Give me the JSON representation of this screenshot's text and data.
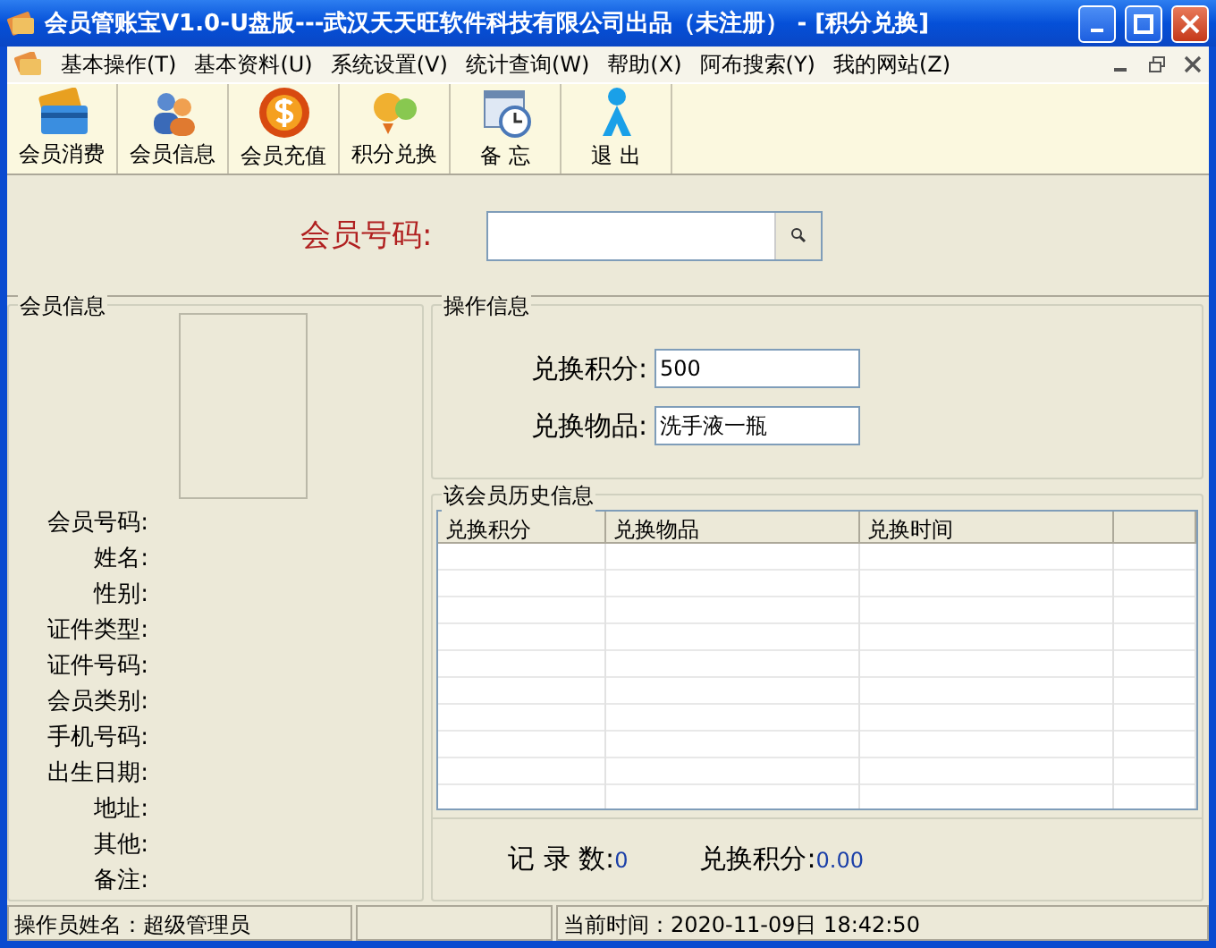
{
  "window": {
    "title": "会员管账宝V1.0-U盘版---武汉天天旺软件科技有限公司出品（未注册） - [积分兑换]"
  },
  "menu": [
    "基本操作(T)",
    "基本资料(U)",
    "系统设置(V)",
    "统计查询(W)",
    "帮助(X)",
    "阿布搜索(Y)",
    "我的网站(Z)"
  ],
  "toolbar": [
    {
      "kind": "card",
      "label": "会员消费"
    },
    {
      "kind": "people",
      "label": "会员信息"
    },
    {
      "kind": "coin",
      "label": "会员充值"
    },
    {
      "kind": "exchange",
      "label": "积分兑换"
    },
    {
      "kind": "memo",
      "label": "备 忘"
    },
    {
      "kind": "exit",
      "label": "退 出"
    }
  ],
  "search": {
    "label": "会员号码:"
  },
  "member_info": {
    "title": "会员信息",
    "fields": [
      "会员号码:",
      "姓名:",
      "性别:",
      "证件类型:",
      "证件号码:",
      "会员类别:",
      "手机号码:",
      "出生日期:",
      "地址:",
      "其他:",
      "备注:"
    ]
  },
  "operation": {
    "title": "操作信息",
    "fields": [
      {
        "label": "兑换积分:",
        "value": "500"
      },
      {
        "label": "兑换物品:",
        "value": "洗手液一瓶"
      }
    ]
  },
  "history": {
    "title": "该会员历史信息",
    "columns": [
      "兑换积分",
      "兑换物品",
      "兑换时间"
    ]
  },
  "summary": [
    {
      "label": "记 录 数:",
      "value": "0"
    },
    {
      "label": "兑换积分:",
      "value": "0.00"
    }
  ],
  "status_bar": [
    "操作员姓名：超级管理员",
    "当前时间：2020-11-09日 18:42:50"
  ]
}
